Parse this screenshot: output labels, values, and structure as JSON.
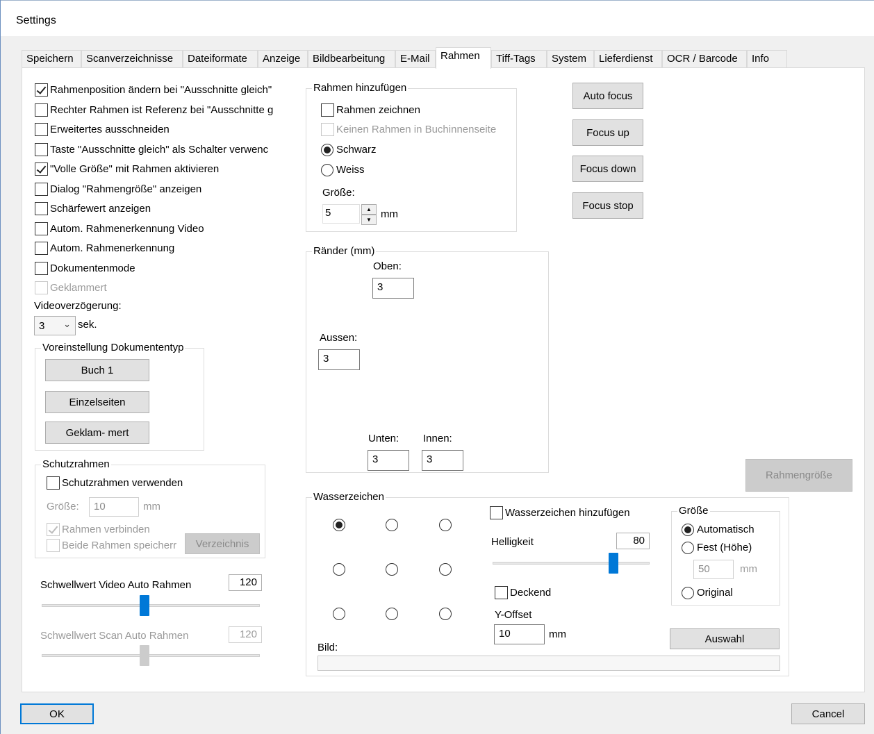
{
  "window": {
    "title": "Settings"
  },
  "tabs": [
    {
      "label": "Speichern"
    },
    {
      "label": "Scanverzeichnisse"
    },
    {
      "label": "Dateiformate"
    },
    {
      "label": "Anzeige"
    },
    {
      "label": "Bildbearbeitung"
    },
    {
      "label": "E-Mail"
    },
    {
      "label": "Rahmen"
    },
    {
      "label": "Tiff-Tags"
    },
    {
      "label": "System"
    },
    {
      "label": "Lieferdienst"
    },
    {
      "label": "OCR / Barcode"
    },
    {
      "label": "Info"
    }
  ],
  "active_tab": "Rahmen",
  "options": [
    {
      "label": "Rahmenposition ändern bei \"Ausschnitte gleich\"",
      "checked": true,
      "enabled": true
    },
    {
      "label": "Rechter Rahmen ist Referenz bei \"Ausschnitte g",
      "checked": false,
      "enabled": true
    },
    {
      "label": "Erweitertes ausschneiden",
      "checked": false,
      "enabled": true
    },
    {
      "label": "Taste \"Ausschnitte gleich\" als Schalter verwenc",
      "checked": false,
      "enabled": true
    },
    {
      "label": "\"Volle Größe\" mit Rahmen aktivieren",
      "checked": true,
      "enabled": true
    },
    {
      "label": "Dialog \"Rahmengröße\" anzeigen",
      "checked": false,
      "enabled": true
    },
    {
      "label": "Schärfewert anzeigen",
      "checked": false,
      "enabled": true
    },
    {
      "label": "Autom. Rahmenerkennung Video",
      "checked": false,
      "enabled": true
    },
    {
      "label": "Autom. Rahmenerkennung",
      "checked": false,
      "enabled": true
    },
    {
      "label": "Dokumentenmode",
      "checked": false,
      "enabled": true
    },
    {
      "label": "Geklammert",
      "checked": false,
      "enabled": false
    }
  ],
  "video_delay": {
    "label": "Videoverzögerung:",
    "value": "3",
    "unit": "sek."
  },
  "doc_type": {
    "title": "Voreinstellung Dokumententyp",
    "buttons": [
      "Buch 1",
      "Einzelseiten",
      "Geklam- mert"
    ]
  },
  "schutzrahmen": {
    "title": "Schutzrahmen",
    "use_label": "Schutzrahmen verwenden",
    "use_checked": false,
    "size_label": "Größe:",
    "size_value": "10",
    "size_unit": "mm",
    "connect_label": "Rahmen verbinden",
    "connect_checked": true,
    "save_both_label": "Beide Rahmen speicherr",
    "save_both_checked": false,
    "dir_button": "Verzeichnis"
  },
  "threshold_video": {
    "label": "Schwellwert Video Auto Rahmen",
    "value": "120",
    "level_percent": 47
  },
  "threshold_scan": {
    "label": "Schwellwert Scan Auto Rahmen",
    "value": "120",
    "level_percent": 47
  },
  "frame_add": {
    "title": "Rahmen hinzufügen",
    "draw_label": "Rahmen zeichnen",
    "draw_checked": false,
    "no_inner_label": "Keinen Rahmen in Buchinnenseite",
    "no_inner_checked": false,
    "black_label": "Schwarz",
    "white_label": "Weiss",
    "selected_color": "Schwarz",
    "size_label": "Größe:",
    "size_value": "5",
    "size_unit": "mm"
  },
  "margins": {
    "title": "Ränder (mm)",
    "top_label": "Oben:",
    "top_value": "3",
    "outer_label": "Aussen:",
    "outer_value": "3",
    "bottom_label": "Unten:",
    "bottom_value": "3",
    "inner_label": "Innen:",
    "inner_value": "3"
  },
  "focus_buttons": [
    "Auto focus",
    "Focus up",
    "Focus down",
    "Focus stop"
  ],
  "frame_size_button": "Rahmengröße",
  "watermark": {
    "title": "Wasserzeichen",
    "position_selected_index": 0,
    "add_label": "Wasserzeichen hinzufügen",
    "add_checked": false,
    "brightness_label": "Helligkeit",
    "brightness_value": "80",
    "brightness_level_percent": 77,
    "opaque_label": "Deckend",
    "opaque_checked": false,
    "yoffset_label": "Y-Offset",
    "yoffset_value": "10",
    "yoffset_unit": "mm",
    "image_label": "Bild:",
    "image_value": "",
    "size_title": "Größe",
    "size_auto": "Automatisch",
    "size_fixed": "Fest (Höhe)",
    "size_fixed_value": "50",
    "size_fixed_unit": "mm",
    "size_original": "Original",
    "size_selected": "Automatisch",
    "select_button": "Auswahl"
  },
  "footer": {
    "ok": "OK",
    "cancel": "Cancel"
  },
  "colors": {
    "accent": "#0078d7",
    "panel": "#ffffff",
    "window": "#f0f0f0"
  }
}
